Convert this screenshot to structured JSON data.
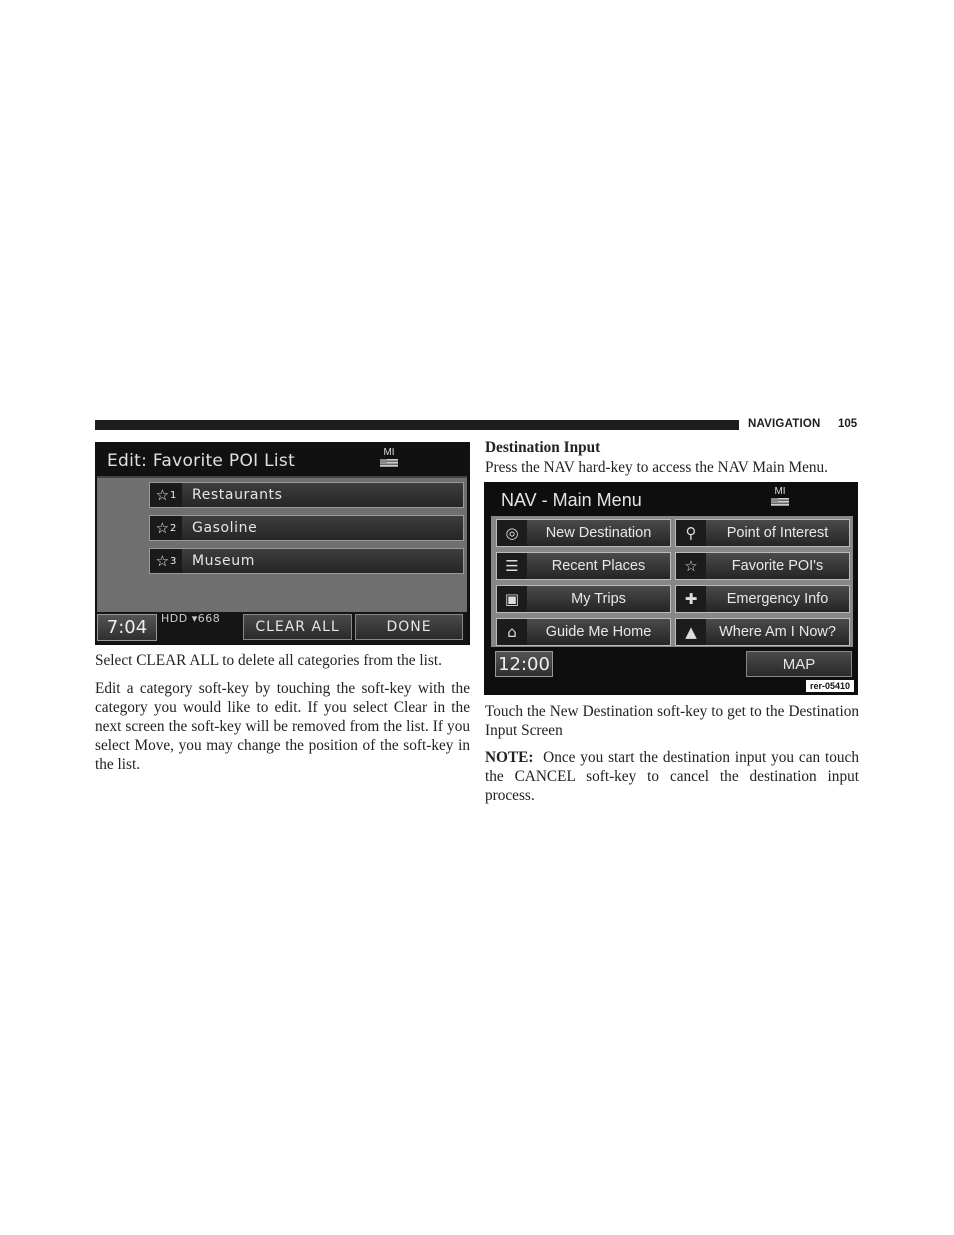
{
  "page_header": {
    "section": "NAVIGATION",
    "page_number": "105"
  },
  "screen_favorites": {
    "title": "Edit: Favorite POI List",
    "units_label": "MI",
    "items": [
      {
        "number": "1",
        "label": "Restaurants",
        "icon": "star-icon"
      },
      {
        "number": "2",
        "label": "Gasoline",
        "icon": "star-icon"
      },
      {
        "number": "3",
        "label": "Museum",
        "icon": "star-icon"
      }
    ],
    "time": "7:04",
    "status": "HDD ▾668",
    "buttons": {
      "clear_all": "CLEAR ALL",
      "done": "DONE"
    }
  },
  "left_text": {
    "para1": "Select CLEAR ALL to delete all categories from the list.",
    "para2": "Edit a category soft-key by touching the soft-key with the category you would like to edit. If you select Clear in the next screen the soft-key will be removed from the list. If you select Move, you may change the position of the soft-key in the list."
  },
  "right_text": {
    "heading": "Destination Input",
    "intro": "Press the NAV hard-key to access the NAV Main Menu.",
    "para1": "Touch the New Destination soft-key to get to the Destination Input Screen",
    "note_label": "NOTE:",
    "note_text": "Once you start the destination input you can touch the CANCEL soft-key to cancel the destination input process."
  },
  "screen_nav": {
    "title": "NAV - Main Menu",
    "units_label": "MI",
    "buttons": [
      {
        "label": "New Destination",
        "icon": "target-icon",
        "glyph": "◎"
      },
      {
        "label": "Point of Interest",
        "icon": "poi-search-icon",
        "glyph": "⚲"
      },
      {
        "label": "Recent Places",
        "icon": "list-icon",
        "glyph": "☰"
      },
      {
        "label": "Favorite POI's",
        "icon": "star-icon",
        "glyph": "☆"
      },
      {
        "label": "My Trips",
        "icon": "suitcase-icon",
        "glyph": "▣"
      },
      {
        "label": "Emergency Info",
        "icon": "cross-icon",
        "glyph": "✚"
      },
      {
        "label": "Guide Me Home",
        "icon": "home-icon",
        "glyph": "⌂"
      },
      {
        "label": "Where Am I Now?",
        "icon": "compass-arrow-icon",
        "glyph": "▲"
      }
    ],
    "time": "12:00",
    "map_label": "MAP",
    "figure_id": "rer-05410"
  }
}
